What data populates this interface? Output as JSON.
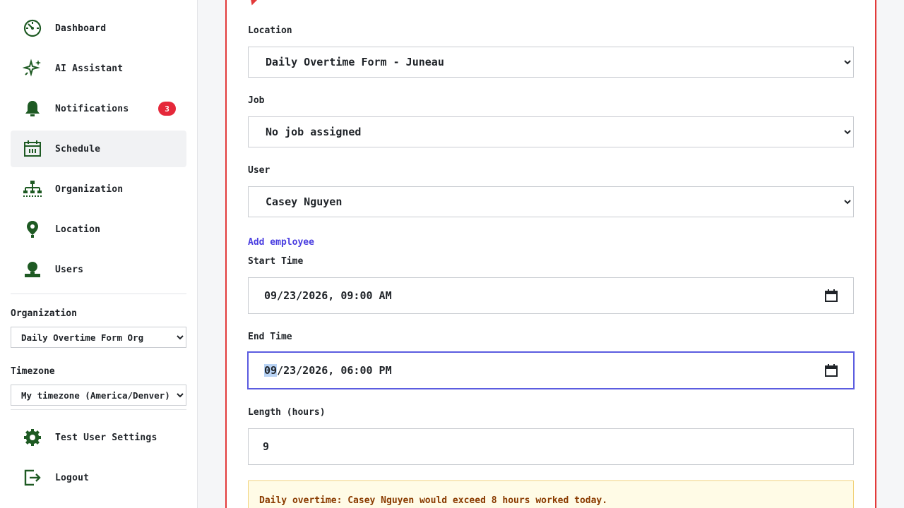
{
  "sidebar": {
    "nav": [
      {
        "label": "Dashboard",
        "icon": "dashboard-icon"
      },
      {
        "label": "AI Assistant",
        "icon": "sparkle-icon"
      },
      {
        "label": "Notifications",
        "icon": "bell-icon",
        "badge": "3"
      },
      {
        "label": "Schedule",
        "icon": "calendar-icon",
        "active": true
      },
      {
        "label": "Organization",
        "icon": "org-chart-icon"
      },
      {
        "label": "Location",
        "icon": "map-pin-icon"
      },
      {
        "label": "Users",
        "icon": "user-icon"
      }
    ],
    "organization_label": "Organization",
    "organization_value": "Daily Overtime Form Org",
    "timezone_label": "Timezone",
    "timezone_value": "My timezone (America/Denver)",
    "bottom": [
      {
        "label": "Test User Settings",
        "icon": "gear-icon"
      },
      {
        "label": "Logout",
        "icon": "logout-icon"
      }
    ]
  },
  "form": {
    "location_label": "Location",
    "location_value": "Daily Overtime Form - Juneau",
    "job_label": "Job",
    "job_value": "No job assigned",
    "user_label": "User",
    "user_value": "Casey Nguyen",
    "add_employee": "Add employee",
    "start_label": "Start Time",
    "start_value": "09/23/2026, 09:00 AM",
    "end_label": "End Time",
    "end_value_month": "09",
    "end_value_rest": "/23/2026, 06:00 PM",
    "length_label": "Length (hours)",
    "length_value": "9",
    "warning": "Daily overtime: Casey Nguyen would exceed 8 hours worked today."
  },
  "colors": {
    "icon_green": "#1e5a23",
    "accent_red": "#e23a3a",
    "focus": "#5b5ce0",
    "link": "#4a3ee0"
  }
}
